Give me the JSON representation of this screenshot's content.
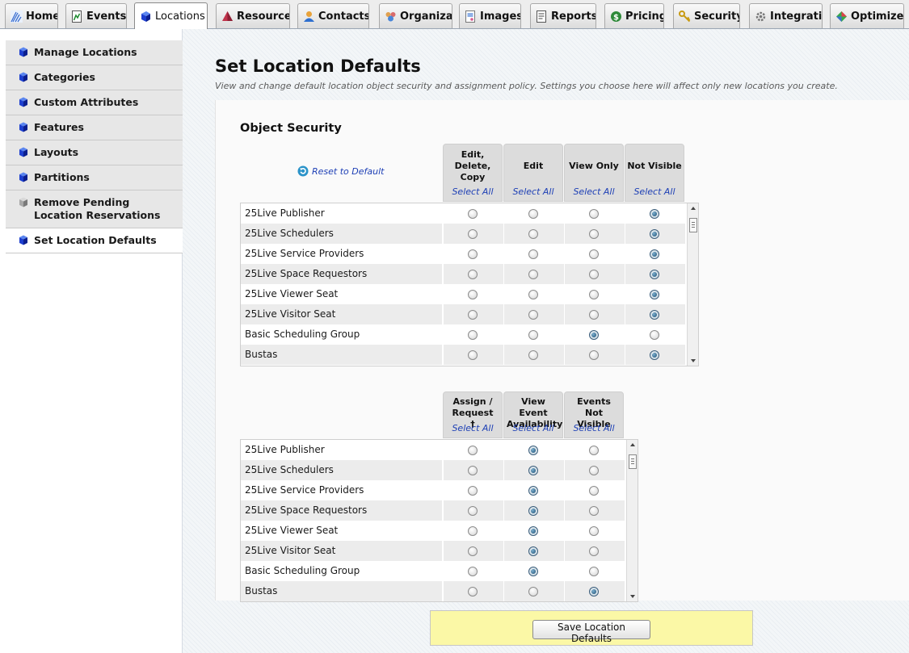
{
  "tabs": [
    {
      "label": "Home",
      "icon": "home-icon"
    },
    {
      "label": "Events",
      "icon": "events-icon"
    },
    {
      "label": "Locations",
      "icon": "cube-icon",
      "active": true
    },
    {
      "label": "Resources",
      "icon": "resources-icon"
    },
    {
      "label": "Contacts",
      "icon": "contacts-icon"
    },
    {
      "label": "Organizati",
      "icon": "organizations-icon"
    },
    {
      "label": "Images",
      "icon": "images-icon"
    },
    {
      "label": "Reports",
      "icon": "reports-icon"
    },
    {
      "label": "Pricing",
      "icon": "pricing-icon"
    },
    {
      "label": "Security",
      "icon": "key-icon"
    },
    {
      "label": "Integratio",
      "icon": "integration-icon"
    },
    {
      "label": "Optimizer",
      "icon": "optimizer-icon"
    }
  ],
  "sidebar": {
    "items": [
      {
        "label": "Manage Locations",
        "icon": "cube-icon"
      },
      {
        "label": "Categories",
        "icon": "cube-icon"
      },
      {
        "label": "Custom Attributes",
        "icon": "cube-icon"
      },
      {
        "label": "Features",
        "icon": "cube-icon"
      },
      {
        "label": "Layouts",
        "icon": "cube-icon"
      },
      {
        "label": "Partitions",
        "icon": "cube-icon"
      },
      {
        "label": "Remove Pending Location Reservations",
        "icon": "gray-cube-icon"
      },
      {
        "label": "Set Location Defaults",
        "icon": "cube-icon",
        "active": true
      }
    ]
  },
  "main": {
    "title": "Set Location Defaults",
    "subtitle": "View and change default location object security and assignment policy. Settings you choose here will affect only new locations you create.",
    "object_security": {
      "heading": "Object Security",
      "reset_label": "Reset to Default",
      "select_all_label": "Select All",
      "columns": [
        "Edit, Delete, Copy",
        "Edit",
        "View Only",
        "Not Visible"
      ],
      "rows": [
        {
          "name": "25Live Publisher",
          "selected": 3
        },
        {
          "name": "25Live Schedulers",
          "selected": 3
        },
        {
          "name": "25Live Service Providers",
          "selected": 3
        },
        {
          "name": "25Live Space Requestors",
          "selected": 3
        },
        {
          "name": "25Live Viewer Seat",
          "selected": 3
        },
        {
          "name": "25Live Visitor Seat",
          "selected": 3
        },
        {
          "name": "Basic Scheduling Group",
          "selected": 2
        },
        {
          "name": "Bustas",
          "selected": 3
        }
      ]
    },
    "assignment": {
      "select_all_label": "Select All",
      "columns": [
        "Assign / Request †",
        "View Event Availability",
        "Events Not Visible"
      ],
      "rows": [
        {
          "name": "25Live Publisher",
          "selected": 1
        },
        {
          "name": "25Live Schedulers",
          "selected": 1
        },
        {
          "name": "25Live Service Providers",
          "selected": 1
        },
        {
          "name": "25Live Space Requestors",
          "selected": 1
        },
        {
          "name": "25Live Viewer Seat",
          "selected": 1
        },
        {
          "name": "25Live Visitor Seat",
          "selected": 1
        },
        {
          "name": "Basic Scheduling Group",
          "selected": 1
        },
        {
          "name": "Bustas",
          "selected": 2
        }
      ]
    },
    "save_label": "Save Location Defaults"
  },
  "colors": {
    "link": "#1d3fb5",
    "save_bar": "#fbf8a6",
    "radio_selected": "#1d4f74",
    "header_bg": "#dcdcdc"
  }
}
